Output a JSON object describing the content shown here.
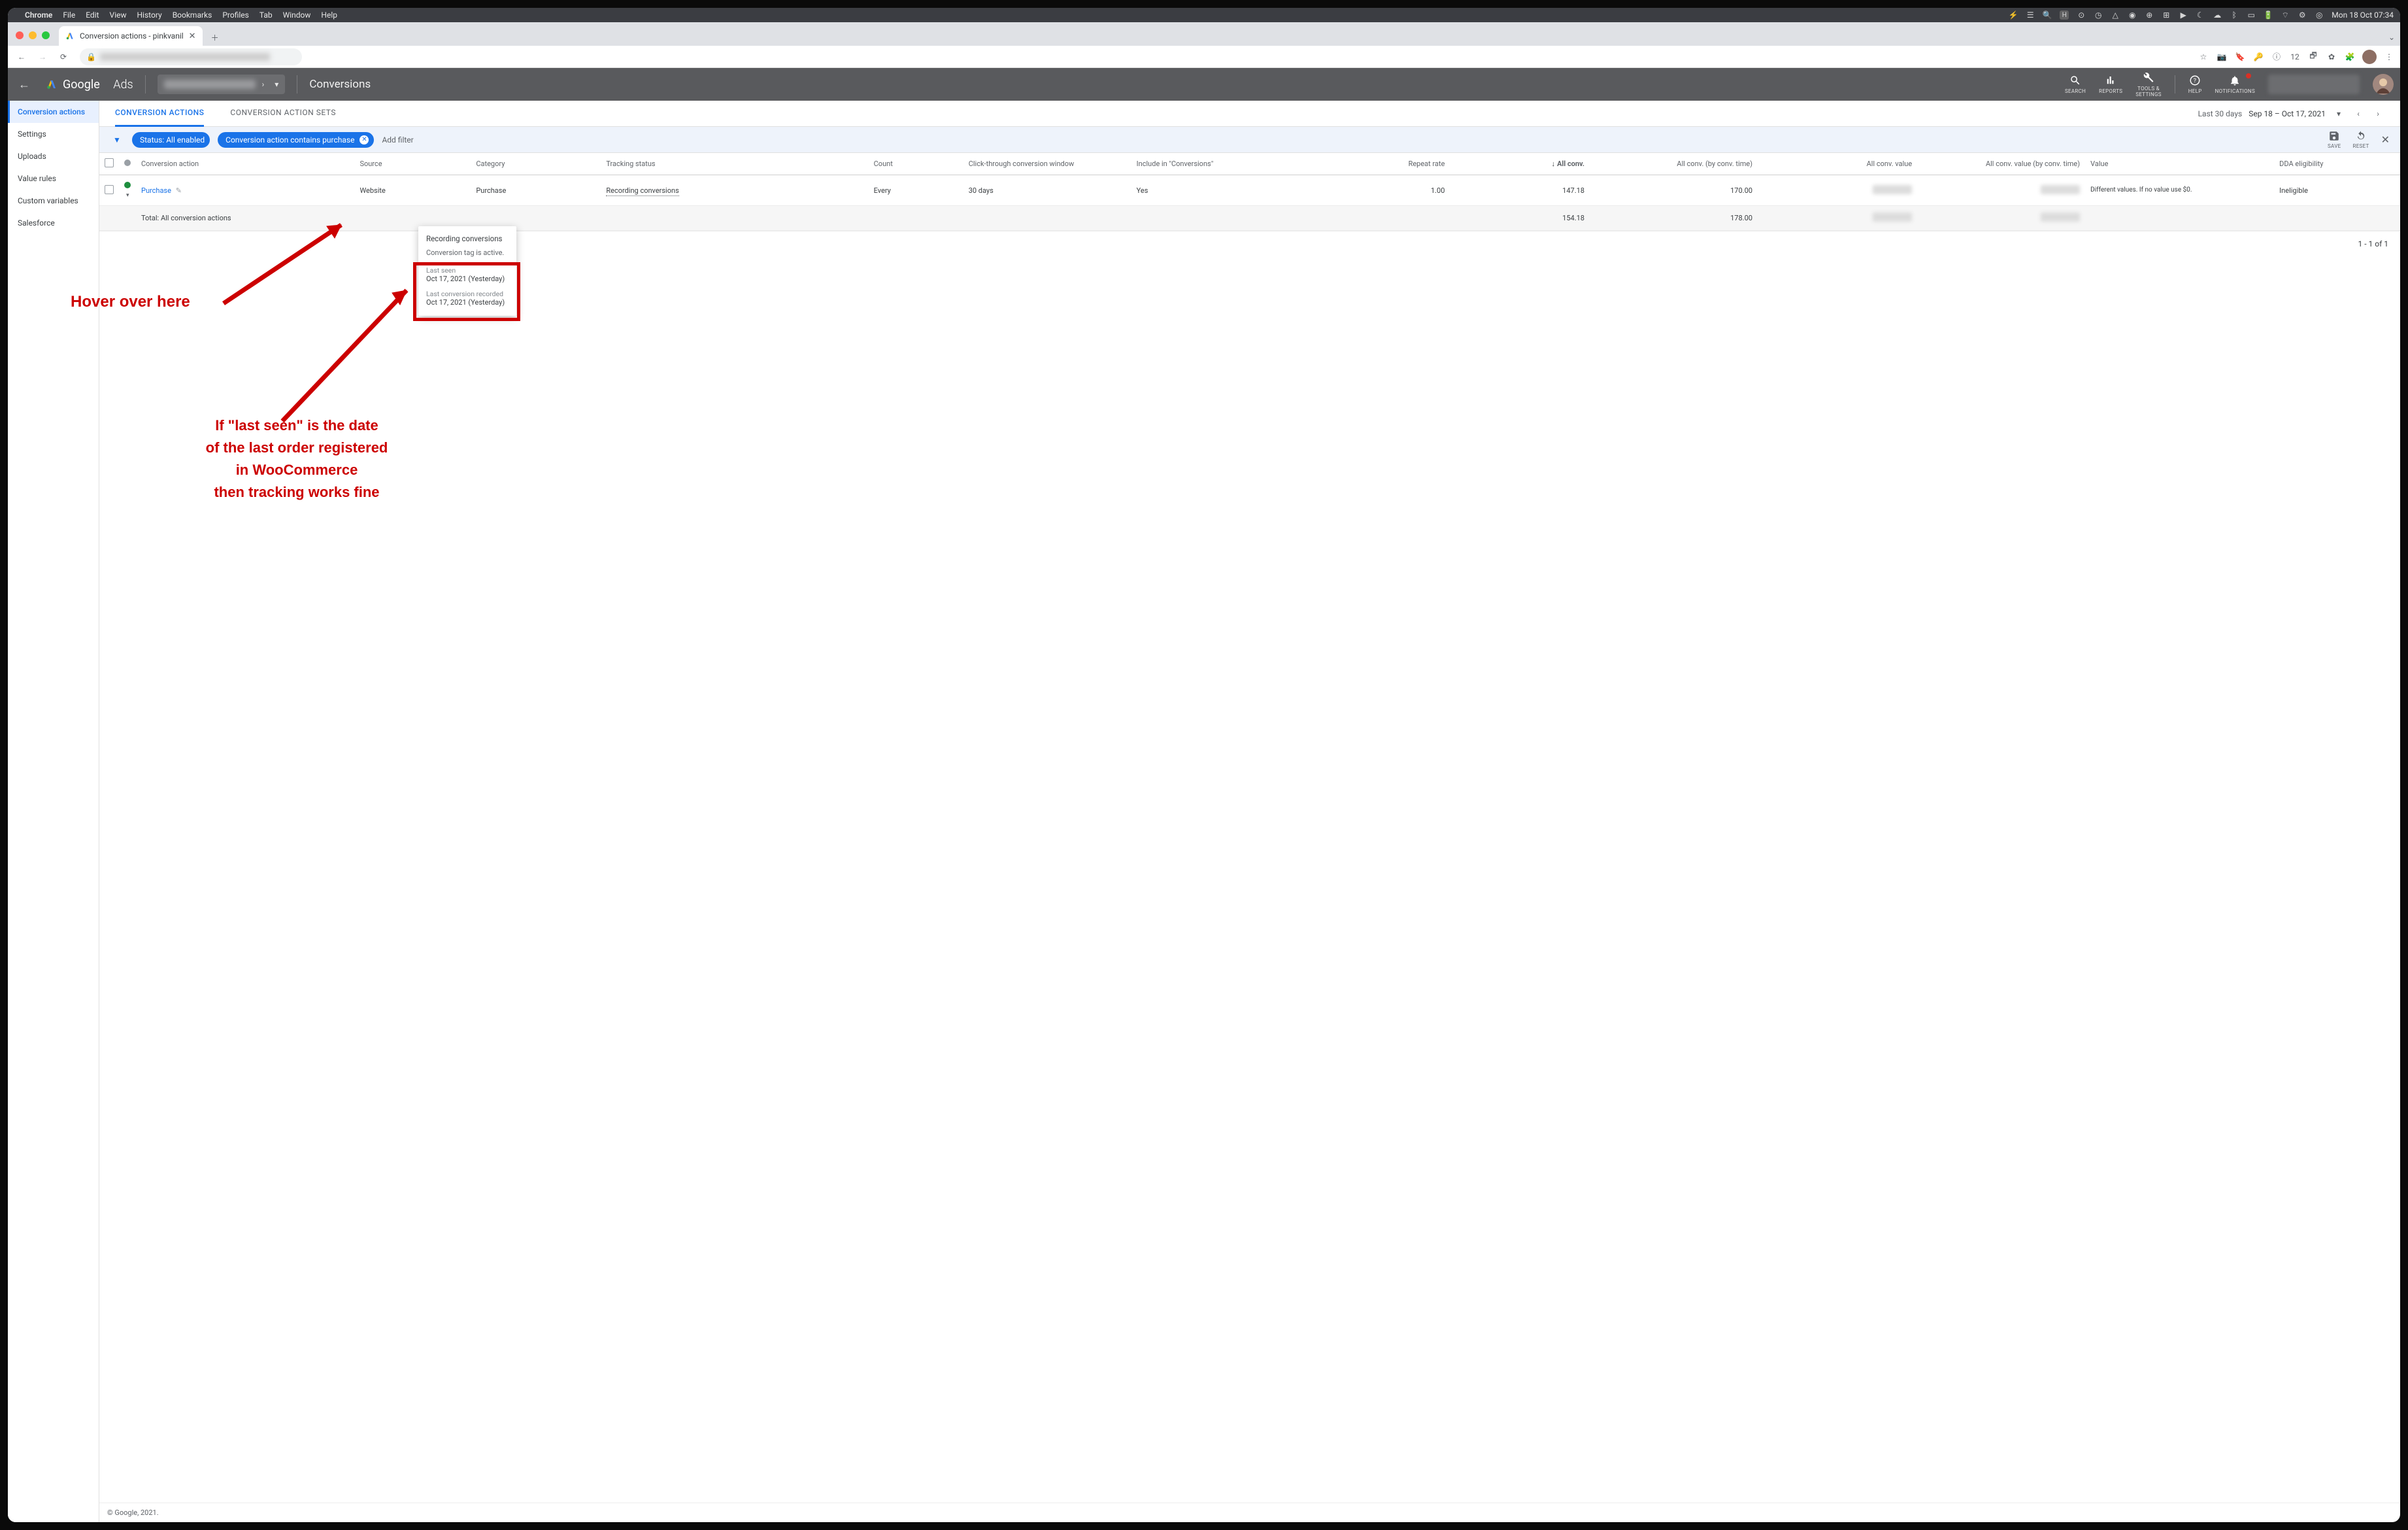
{
  "macmenu": {
    "app": "Chrome",
    "items": [
      "File",
      "Edit",
      "View",
      "History",
      "Bookmarks",
      "Profiles",
      "Tab",
      "Window",
      "Help"
    ],
    "clock": "Mon 18 Oct  07:34"
  },
  "browser": {
    "tab_title": "Conversion actions - pinkvanil",
    "new_tab_tooltip": "+",
    "omnibox_value": "",
    "ext_badge": "12"
  },
  "gads": {
    "product": "Google",
    "product_suffix": "Ads",
    "page_title": "Conversions",
    "tools": {
      "search": "SEARCH",
      "reports": "REPORTS",
      "tools": "TOOLS &\nSETTINGS",
      "help": "HELP",
      "notifications": "NOTIFICATIONS"
    }
  },
  "leftnav": {
    "items": [
      "Conversion actions",
      "Settings",
      "Uploads",
      "Value rules",
      "Custom variables",
      "Salesforce"
    ],
    "active_index": 0
  },
  "tabs": {
    "items": [
      "CONVERSION ACTIONS",
      "CONVERSION ACTION SETS"
    ],
    "active_index": 0,
    "date_label": "Last 30 days",
    "date_range": "Sep 18 – Oct 17, 2021"
  },
  "filters": {
    "status_chip": "Status: All enabled",
    "query_chip": "Conversion action contains purchase",
    "add_filter": "Add filter",
    "save": "SAVE",
    "reset": "RESET"
  },
  "table": {
    "columns": {
      "conversion_action": "Conversion action",
      "source": "Source",
      "category": "Category",
      "tracking_status": "Tracking status",
      "count": "Count",
      "window": "Click-through conversion window",
      "include": "Include in \"Conversions\"",
      "repeat": "Repeat rate",
      "all_conv": "All conv.",
      "all_conv_by_time": "All conv. (by conv. time)",
      "all_conv_value": "All conv. value",
      "all_conv_value_by_time": "All conv. value (by conv. time)",
      "value": "Value",
      "dda": "DDA eligibility"
    },
    "rows": [
      {
        "name": "Purchase",
        "source": "Website",
        "category": "Purchase",
        "tracking_status": "Recording conversions",
        "count": "Every",
        "window": "30 days",
        "include": "Yes",
        "repeat": "1.00",
        "all_conv": "147.18",
        "all_conv_by_time": "170.00",
        "value": "Different values. If no value use $0.",
        "dda": "Ineligible"
      }
    ],
    "total_label": "Total: All conversion actions",
    "totals": {
      "all_conv": "154.18",
      "all_conv_by_time": "178.00"
    },
    "pager": "1 - 1 of 1"
  },
  "popover": {
    "title": "Recording conversions",
    "subtitle": "Conversion tag is active.",
    "last_seen_label": "Last seen",
    "last_seen_value": "Oct 17, 2021 (Yesterday)",
    "last_conv_label": "Last conversion recorded",
    "last_conv_value": "Oct 17, 2021 (Yesterday)"
  },
  "annotations": {
    "hover": "Hover over here",
    "explain_line1": "If \"last seen\" is the date",
    "explain_line2": "of the last order registered",
    "explain_line3": "in WooCommerce",
    "explain_line4": "then tracking works fine"
  },
  "footer": {
    "copyright": "© Google, 2021."
  }
}
